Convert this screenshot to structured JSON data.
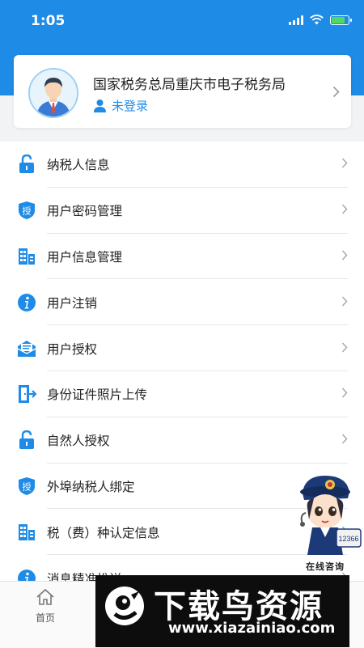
{
  "status_bar": {
    "time": "1:05"
  },
  "profile": {
    "org_name": "国家税务总局重庆市电子税务局",
    "login_status": "未登录"
  },
  "menu": [
    {
      "label": "纳税人信息",
      "icon": "lock-icon"
    },
    {
      "label": "用户密码管理",
      "icon": "shield-auth-icon"
    },
    {
      "label": "用户信息管理",
      "icon": "building-icon"
    },
    {
      "label": "用户注销",
      "icon": "info-icon"
    },
    {
      "label": "用户授权",
      "icon": "mail-icon"
    },
    {
      "label": "身份证件照片上传",
      "icon": "door-exit-icon"
    },
    {
      "label": "自然人授权",
      "icon": "lock-icon"
    },
    {
      "label": "外埠纳税人绑定",
      "icon": "shield-auth-icon"
    },
    {
      "label": "税（费）种认定信息",
      "icon": "building-icon"
    },
    {
      "label": "消息精准推送",
      "icon": "info-icon"
    }
  ],
  "shield_glyph": "授",
  "mascot": {
    "label": "在线咨询",
    "phone": "12366"
  },
  "tabbar": {
    "home_label": "首页"
  },
  "watermark": {
    "title": "下载鸟资源",
    "url": "www.xiazainiao.com"
  },
  "colors": {
    "primary": "#1e8be6",
    "background": "#f2f3f5"
  }
}
